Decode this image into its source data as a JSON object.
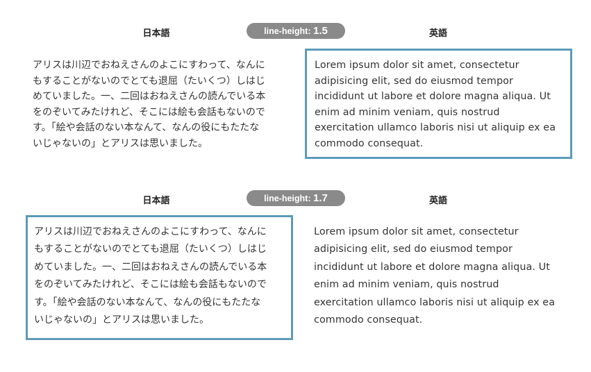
{
  "sections": [
    {
      "ja_header": "日本語",
      "pill_label": "line-height:",
      "pill_value": "1.5",
      "en_header": "英語",
      "highlighted": "en"
    },
    {
      "ja_header": "日本語",
      "pill_label": "line-height:",
      "pill_value": "1.7",
      "en_header": "英語",
      "highlighted": "ja"
    }
  ],
  "ja_lines": [
    "アリスは川辺でおねえさんのよこにすわって、なんに",
    "もすることがないのでとても退屈（たいくつ）しはじ",
    "めていました。一、二回はおねえさんの読んでいる本",
    "をのぞいてみたけれど、そこには絵も会話もないので",
    "す。「絵や会話のない本なんて、なんの役にもたたな",
    "いじゃないの」とアリスは思いました。"
  ],
  "en_lines": [
    "Lorem ipsum dolor sit amet, consectetur",
    "adipisicing elit, sed do eiusmod tempor",
    "incididunt ut labore et dolore magna aliqua. Ut",
    "enim ad minim veniam, quis nostrud",
    "exercitation ullamco laboris nisi ut aliquip ex ea",
    "commodo consequat."
  ],
  "colors": {
    "highlight_border": "#5b9bba",
    "pill_bg": "#8a8a8a"
  }
}
